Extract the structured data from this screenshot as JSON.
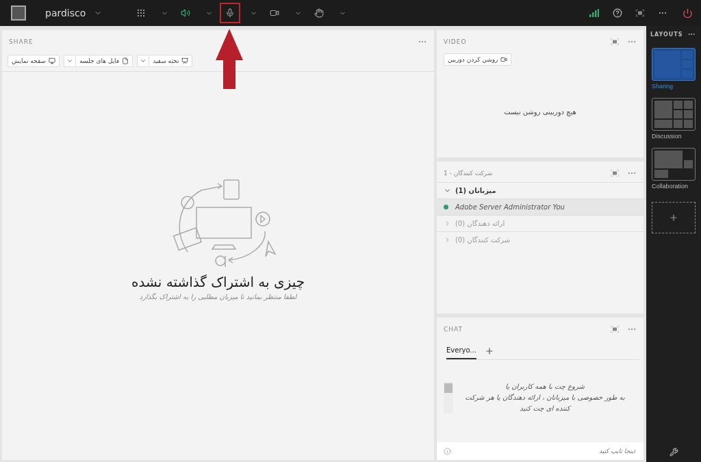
{
  "topbar": {
    "room": "pardisco",
    "tools": [
      {
        "kind": "apps",
        "highlighted": false
      },
      {
        "kind": "speaker",
        "highlighted": false
      },
      {
        "kind": "mic",
        "highlighted": true
      },
      {
        "kind": "camera",
        "highlighted": false
      },
      {
        "kind": "hand",
        "highlighted": false
      }
    ]
  },
  "share": {
    "title": "SHARE",
    "buttons": [
      {
        "label": "تخته سفید",
        "dropdown": true
      },
      {
        "label": "فایل های جلسه",
        "dropdown": true
      },
      {
        "label": "صفحه نمایش",
        "dropdown": false
      }
    ],
    "heading": "چیزی به اشتراک گذاشته نشده",
    "subtext": "لطفا منتظر بمانید تا میزبان مطلبی را به اشتراک بگذارد"
  },
  "video": {
    "title": "VIDEO",
    "button": "روشن کردن دوربین",
    "message": "هیچ دوربینی روشن نیست"
  },
  "attendees": {
    "title": "شرکت کنندگان - 1",
    "groups": [
      {
        "label": "میزبانان (1)",
        "expanded": true,
        "children": [
          {
            "name": "Adobe Server Administrator You",
            "color": "#2e9e6e"
          }
        ]
      },
      {
        "label": "ارائه دهندگان (0)",
        "expanded": false
      },
      {
        "label": "شرکت کنندگان (0)",
        "expanded": false
      }
    ]
  },
  "chat": {
    "title": "CHAT",
    "tabs": [
      {
        "label": "Everyo...",
        "selected": true
      }
    ],
    "message": "شروع چت با همه کاربران یا\nبه طور خصوصی با میزبانان ، ارائه دهندگان یا هر شرکت\nکننده ای چت کنید",
    "placeholder": "اینجا تایپ کنید"
  },
  "layouts": {
    "title": "LAYOUTS",
    "items": [
      {
        "label": "Sharing",
        "kind": "sharing",
        "selected": true
      },
      {
        "label": "Discussion",
        "kind": "discussion",
        "selected": false
      },
      {
        "label": "Collaboration",
        "kind": "collaboration",
        "selected": false
      }
    ]
  }
}
